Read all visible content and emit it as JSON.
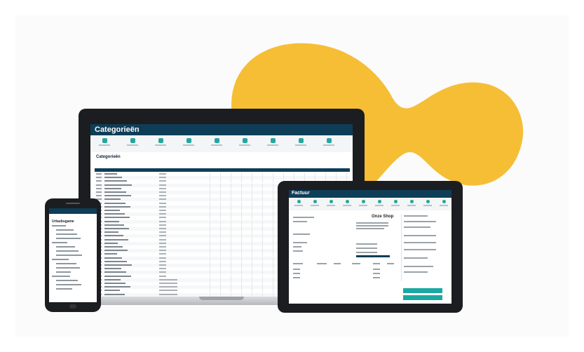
{
  "brand_color": "#f6be35",
  "accent_color": "#0e3d57",
  "teal_color": "#1aa9a2",
  "laptop": {
    "app_title": "Categorieën",
    "section_title": "Categorieën",
    "toolbar_icons": [
      "circle-plus-icon",
      "document-icon",
      "document-icon",
      "document-icon",
      "cloud-icon",
      "document-icon",
      "arrows-icon",
      "document-icon",
      "video-icon"
    ],
    "row_count": 34
  },
  "tablet": {
    "app_title": "Factuur",
    "company_name": "Onze Shop",
    "toolbar_icons": [
      "circle-icon",
      "circle-icon",
      "circle-icon",
      "circle-icon",
      "circle-icon",
      "circle-icon",
      "circle-icon",
      "circle-icon",
      "circle-icon",
      "circle-icon"
    ]
  },
  "phone": {
    "app_title": "Urlaubsgame"
  }
}
